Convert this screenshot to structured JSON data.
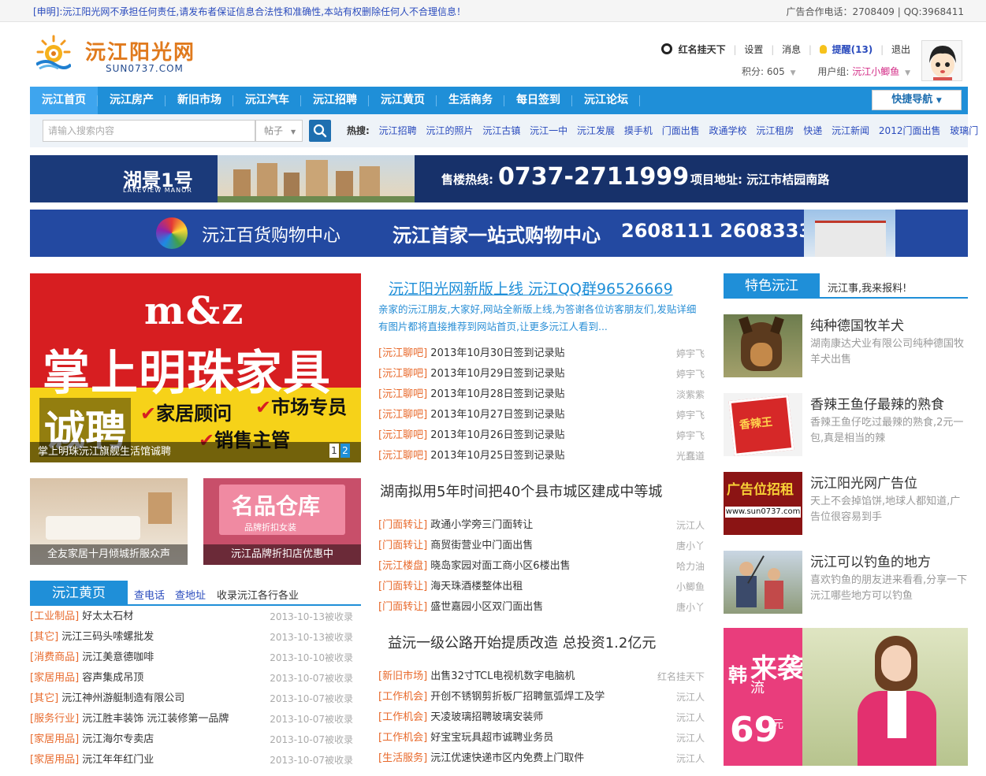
{
  "topbar": {
    "notice": "[申明]:沅江阳光网不承担任何责任,请发布者保证信息合法性和准确性,本站有权删除任何人不合理信息！",
    "ad_contact": "广告合作电话：2708409 | QQ:3968411"
  },
  "logo": {
    "name": "沅江阳光网",
    "domain": "SUN0737.COM"
  },
  "user": {
    "username": "红名挂天下",
    "links": [
      "设置",
      "消息"
    ],
    "remind": "提醒(13)",
    "logout": "退出",
    "points": "积分: 605",
    "group_label": "用户组:",
    "group_value": "沅江小鲫鱼"
  },
  "nav": {
    "items": [
      "沅江首页",
      "沅江房产",
      "新旧市场",
      "沅江汽车",
      "沅江招聘",
      "沅江黄页",
      "生活商务",
      "每日签到",
      "沅江论坛"
    ],
    "quick": "快捷导航"
  },
  "search": {
    "placeholder": "请输入搜索内容",
    "type": "帖子",
    "hot_label": "热搜:",
    "hot": [
      "沅江招聘",
      "沅江的照片",
      "沅江古镇",
      "沅江一中",
      "沅江发展",
      "摸手机",
      "门面出售",
      "政通学校",
      "沅江租房",
      "快递",
      "沅江新闻",
      "2012门面出售",
      "玻璃门"
    ]
  },
  "banner1": {
    "brand": "湖景1号",
    "brand_en": "LAKEVIEW MANOR",
    "hotline_label": "售楼热线:",
    "hotline": "0737-2711999",
    "address": "项目地址: 沅江市桔园南路"
  },
  "banner2": {
    "name": "沅江百货购物中心",
    "slogan": "沅江首家一站式购物中心",
    "phones": "2608111 2608333"
  },
  "promo": {
    "brand_en": "m&z",
    "brand_cn": "掌上明珠家具",
    "recruit": "诚聘",
    "roles": [
      "家居顾问",
      "市场专员",
      "销售主管"
    ],
    "caption": "掌上明珠沅江旗舰生活馆诚聘",
    "pages": [
      "1",
      "2"
    ]
  },
  "thumbs": [
    {
      "caption": "全友家居十月倾城折服众声"
    },
    {
      "caption": "沅江品牌折扣店优惠中",
      "shop": "名品仓库",
      "shop_sub": "品牌折扣女装"
    }
  ],
  "yellowpage": {
    "title": "沅江黄页",
    "links": [
      "查电话",
      "查地址"
    ],
    "note": "收录沅江各行各业",
    "items": [
      {
        "cat": "[工业制品]",
        "title": "好太太石材",
        "date": "2013-10-13被收录"
      },
      {
        "cat": "[其它]",
        "title": "沅江三码头嗦螺批发",
        "date": "2013-10-13被收录"
      },
      {
        "cat": "[消费商品]",
        "title": "沅江美意德咖啡",
        "date": "2013-10-10被收录"
      },
      {
        "cat": "[家居用品]",
        "title": "容声集成吊顶",
        "date": "2013-10-07被收录"
      },
      {
        "cat": "[其它]",
        "title": "沅江神州游艇制造有限公司",
        "date": "2013-10-07被收录"
      },
      {
        "cat": "[服务行业]",
        "title": "沅江胜丰装饰 沅江装修第一品牌",
        "date": "2013-10-07被收录"
      },
      {
        "cat": "[家居用品]",
        "title": "沅江海尔专卖店",
        "date": "2013-10-07被收录"
      },
      {
        "cat": "[家居用品]",
        "title": "沅江年年红门业",
        "date": "2013-10-07被收录"
      }
    ]
  },
  "middle": {
    "headline1": "沅江阳光网新版上线 沅江QQ群96526669",
    "intro": "亲家的沅江朋友,大家好,网站全新版上线,为答谢各位访客朋友们,发贴详细有图片都将直接推荐到网站首页,让更多沅江人看到...",
    "list1": [
      {
        "cat": "[沅江聊吧]",
        "title": "2013年10月30日签到记录贴",
        "author": "婷宇飞"
      },
      {
        "cat": "[沅江聊吧]",
        "title": "2013年10月29日签到记录贴",
        "author": "婷宇飞"
      },
      {
        "cat": "[沅江聊吧]",
        "title": "2013年10月28日签到记录贴",
        "author": "淡紫紫"
      },
      {
        "cat": "[沅江聊吧]",
        "title": "2013年10月27日签到记录贴",
        "author": "婷宇飞"
      },
      {
        "cat": "[沅江聊吧]",
        "title": "2013年10月26日签到记录贴",
        "author": "婷宇飞"
      },
      {
        "cat": "[沅江聊吧]",
        "title": "2013年10月25日签到记录贴",
        "author": "光蠢道"
      }
    ],
    "headline2": "湖南拟用5年时间把40个县市城区建成中等城",
    "list2": [
      {
        "cat": "[门面转让]",
        "title": "政通小学旁三门面转让",
        "author": "沅江人"
      },
      {
        "cat": "[门面转让]",
        "title": "商贸街营业中门面出售",
        "author": "唐小丫"
      },
      {
        "cat": "[沅江楼盘]",
        "title": "晓岛家园对面工商小区6楼出售",
        "author": "哈力油"
      },
      {
        "cat": "[门面转让]",
        "title": "海天珠酒楼整体出租",
        "author": "小鲫鱼"
      },
      {
        "cat": "[门面转让]",
        "title": "盛世嘉园小区双门面出售",
        "author": "唐小丫"
      }
    ],
    "headline3": "益沅一级公路开始提质改造 总投资1.2亿元",
    "list3": [
      {
        "cat": "[新旧市场]",
        "title": "出售32寸TCL电视机数字电脑机",
        "author": "红名挂天下"
      },
      {
        "cat": "[工作机会]",
        "title": "开创不锈钢剪折板厂招聘氩弧焊工及学",
        "author": "沅江人"
      },
      {
        "cat": "[工作机会]",
        "title": "天凌玻璃招聘玻璃安装师",
        "author": "沅江人"
      },
      {
        "cat": "[工作机会]",
        "title": "好宝宝玩具超市诚聘业务员",
        "author": "沅江人"
      },
      {
        "cat": "[生活服务]",
        "title": "沅江优速快递市区内免费上门取件",
        "author": "沅江人"
      }
    ]
  },
  "featured": {
    "title": "特色沅江",
    "tagline": "沅江事,我来报料!",
    "items": [
      {
        "title": "纯种德国牧羊犬",
        "desc": "湖南康达犬业有限公司纯种德国牧羊犬出售"
      },
      {
        "title": "香辣王鱼仔最辣的熟食",
        "desc": "香辣王鱼仔吃过最辣的熟食,2元一包,真是相当的辣",
        "img_text": "香辣王"
      },
      {
        "title": "沅江阳光网广告位",
        "desc": "天上不会掉馅饼,地球人都知道,广告位很容易到手",
        "img_text": "广告位招租",
        "img_url": "www.sun0737.com"
      },
      {
        "title": "沅江可以钓鱼的地方",
        "desc": "喜欢钓鱼的朋友进来看看,分享一下沅江哪些地方可以钓鱼"
      }
    ]
  },
  "ad_right": {
    "line1": "韩",
    "line2": "来袭",
    "line3": "流",
    "price": "69",
    "unit": "元"
  },
  "colors": {
    "nav": "#1f8fd8",
    "category": "#e8692b",
    "link": "#2a4bbd"
  }
}
